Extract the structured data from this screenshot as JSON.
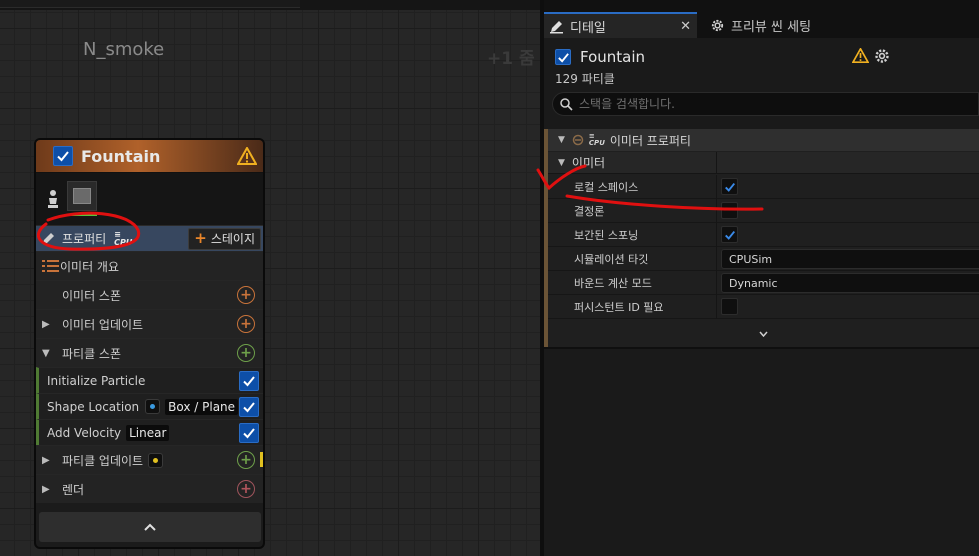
{
  "graph": {
    "title": "N_smoke",
    "zoom_label": "+1 줌"
  },
  "node": {
    "title": "Fountain",
    "properties_label": "프로퍼티",
    "cpu_badge": "CPU",
    "stage_button": "스테이지",
    "summary_label": "이미터 개요",
    "emitter_spawn": "이미터 스폰",
    "emitter_update": "이미터 업데이트",
    "particle_spawn": "파티클 스폰",
    "modules": [
      {
        "label": "Initialize Particle",
        "checked": true
      },
      {
        "label": "Shape Location",
        "pill": "Box / Plane",
        "checked": true
      },
      {
        "label": "Add Velocity",
        "pill": "Linear",
        "checked": true
      }
    ],
    "particle_update": "파티클 업데이트",
    "render": "렌더"
  },
  "details": {
    "tab_details": "디테일",
    "tab_preview": "프리뷰 씬 세팅",
    "object_name": "Fountain",
    "particle_count": "129 파티클",
    "search_placeholder": "스택을 검색합니다.",
    "category": "이미터 프로퍼티",
    "category_cpu": "CPU",
    "subcategory": "이미터",
    "properties": [
      {
        "name": "로컬 스페이스",
        "type": "checkbox",
        "checked": true
      },
      {
        "name": "결정론",
        "type": "checkbox",
        "checked": false
      },
      {
        "name": "보간된 스포닝",
        "type": "checkbox",
        "checked": true
      },
      {
        "name": "시뮬레이션 타깃",
        "type": "dropdown",
        "value": "CPUSim"
      },
      {
        "name": "바운드 계산 모드",
        "type": "dropdown",
        "value": "Dynamic"
      },
      {
        "name": "퍼시스턴트 ID 필요",
        "type": "checkbox",
        "checked": false
      }
    ]
  },
  "colors": {
    "accent_blue": "#0d4fa8",
    "annotation_red": "#e01010",
    "node_header": "#b0612a"
  }
}
